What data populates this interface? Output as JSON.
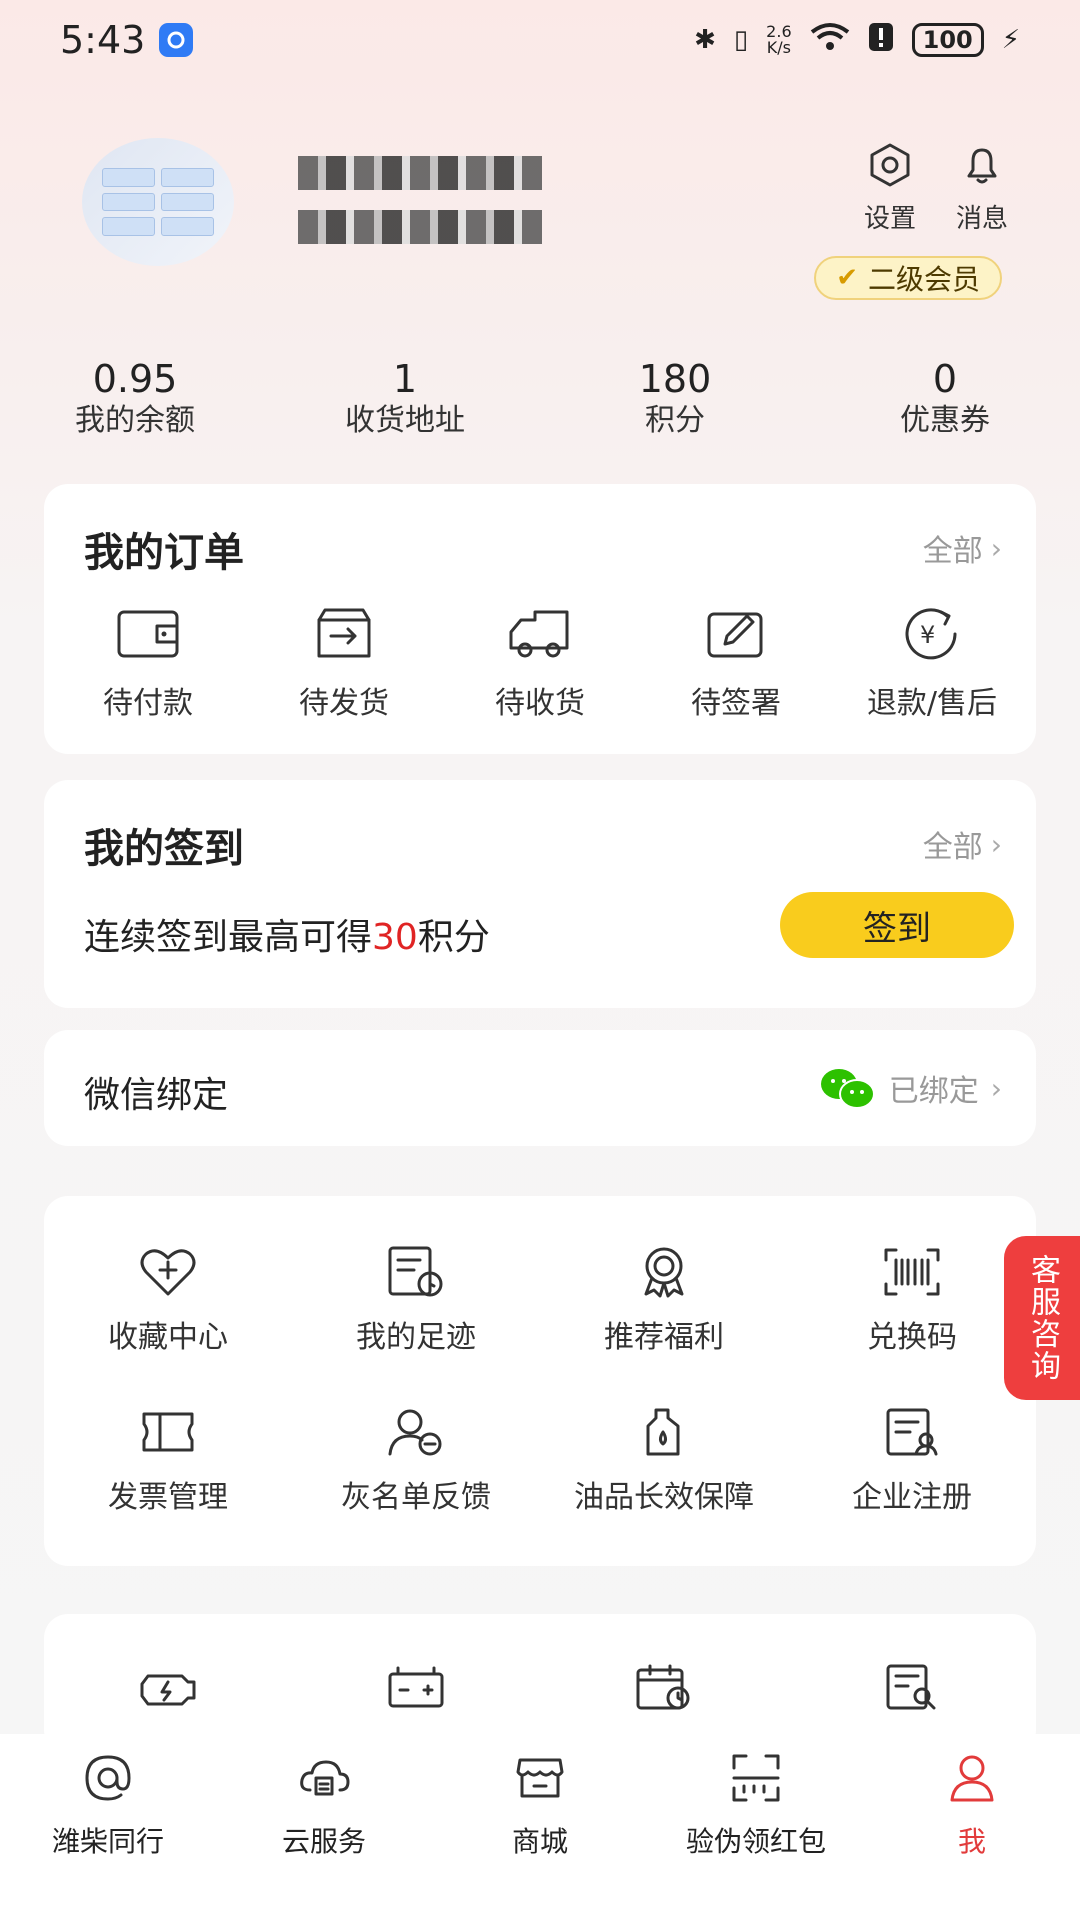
{
  "status_bar": {
    "time": "5:43",
    "speed_value": "2.6",
    "speed_unit": "K/s",
    "battery": "100"
  },
  "profile": {
    "settings_label": "设置",
    "messages_label": "消息",
    "member_level": "二级会员"
  },
  "stats": [
    {
      "value": "0.95",
      "label": "我的余额"
    },
    {
      "value": "1",
      "label": "收货地址"
    },
    {
      "value": "180",
      "label": "积分"
    },
    {
      "value": "0",
      "label": "优惠券"
    }
  ],
  "orders": {
    "title": "我的订单",
    "all_label": "全部",
    "items": [
      "待付款",
      "待发货",
      "待收货",
      "待签署",
      "退款/售后"
    ]
  },
  "signin": {
    "title": "我的签到",
    "all_label": "全部",
    "text_prefix": "连续签到最高可得",
    "text_points": "30",
    "text_suffix": "积分",
    "button_label": "签到"
  },
  "wechat": {
    "title": "微信绑定",
    "status": "已绑定"
  },
  "services": {
    "row1": [
      "收藏中心",
      "我的足迹",
      "推荐福利",
      "兑换码"
    ],
    "row2": [
      "发票管理",
      "灰名单反馈",
      "油品长效保障",
      "企业注册"
    ]
  },
  "customer_service": "客服咨询",
  "bottom_nav": [
    "潍柴同行",
    "云服务",
    "商城",
    "验伪领红包",
    "我"
  ],
  "colors": {
    "accent_red": "#e23b3b",
    "signin_yellow": "#f9cc1d",
    "badge_bg": "#fdf3c7"
  }
}
